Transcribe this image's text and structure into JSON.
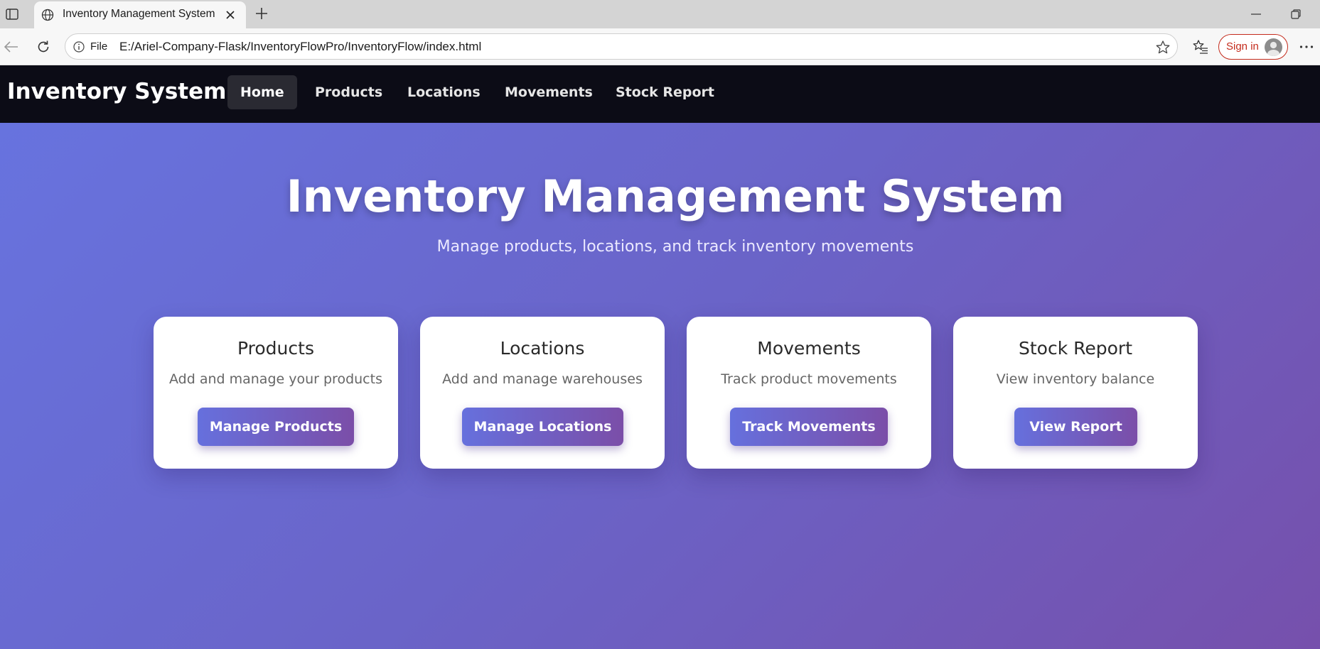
{
  "browser": {
    "tab_title": "Inventory Management System",
    "url_scheme_label": "File",
    "url": "E:/Ariel-Company-Flask/InventoryFlowPro/InventoryFlow/index.html",
    "signin_label": "Sign in"
  },
  "nav": {
    "brand": "Inventory System",
    "links": [
      {
        "label": "Home",
        "active": true
      },
      {
        "label": "Products",
        "active": false
      },
      {
        "label": "Locations",
        "active": false
      },
      {
        "label": "Movements",
        "active": false
      },
      {
        "label": "Stock Report",
        "active": false
      }
    ]
  },
  "hero": {
    "title": "Inventory Management System",
    "subtitle": "Manage products, locations, and track inventory movements"
  },
  "cards": [
    {
      "title": "Products",
      "description": "Add and manage your products",
      "button": "Manage Products"
    },
    {
      "title": "Locations",
      "description": "Add and manage warehouses",
      "button": "Manage Locations"
    },
    {
      "title": "Movements",
      "description": "Track product movements",
      "button": "Track Movements"
    },
    {
      "title": "Stock Report",
      "description": "View inventory balance",
      "button": "View Report"
    }
  ],
  "colors": {
    "nav_background": "#0c0c16",
    "gradient_start": "#6774e0",
    "gradient_end": "#7650ac",
    "signin_accent": "#c42b1c"
  }
}
